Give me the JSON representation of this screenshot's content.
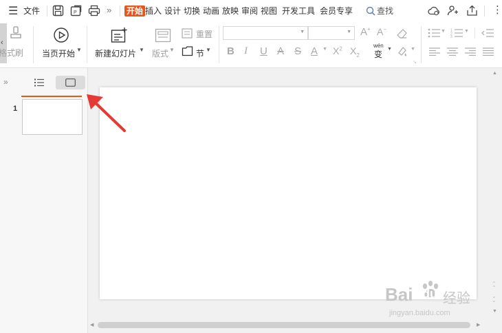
{
  "menubar": {
    "file_label": "文件",
    "tabs": [
      {
        "label": "开始",
        "active": true
      },
      {
        "label": "插入"
      },
      {
        "label": "设计"
      },
      {
        "label": "切换"
      },
      {
        "label": "动画"
      },
      {
        "label": "放映"
      },
      {
        "label": "审阅"
      },
      {
        "label": "视图"
      },
      {
        "label": "开发工具"
      },
      {
        "label": "会员专享"
      }
    ],
    "search_label": "查找"
  },
  "ribbon": {
    "format_painter_label": "格式刷",
    "from_current_label": "当页开始",
    "new_slide_label": "新建幻灯片",
    "layout_label": "版式",
    "reset_label": "重置",
    "section_label": "节",
    "phonetic_label": "wén",
    "phonetic_char": "变"
  },
  "panel": {
    "slide_number": "1"
  },
  "watermark": {
    "brand_left": "Bai",
    "brand_right": "du",
    "brand_cn": "经验",
    "url": "jingyan.baidu.com"
  },
  "colors": {
    "accent": "#e8551d",
    "arrow": "#e53935"
  }
}
